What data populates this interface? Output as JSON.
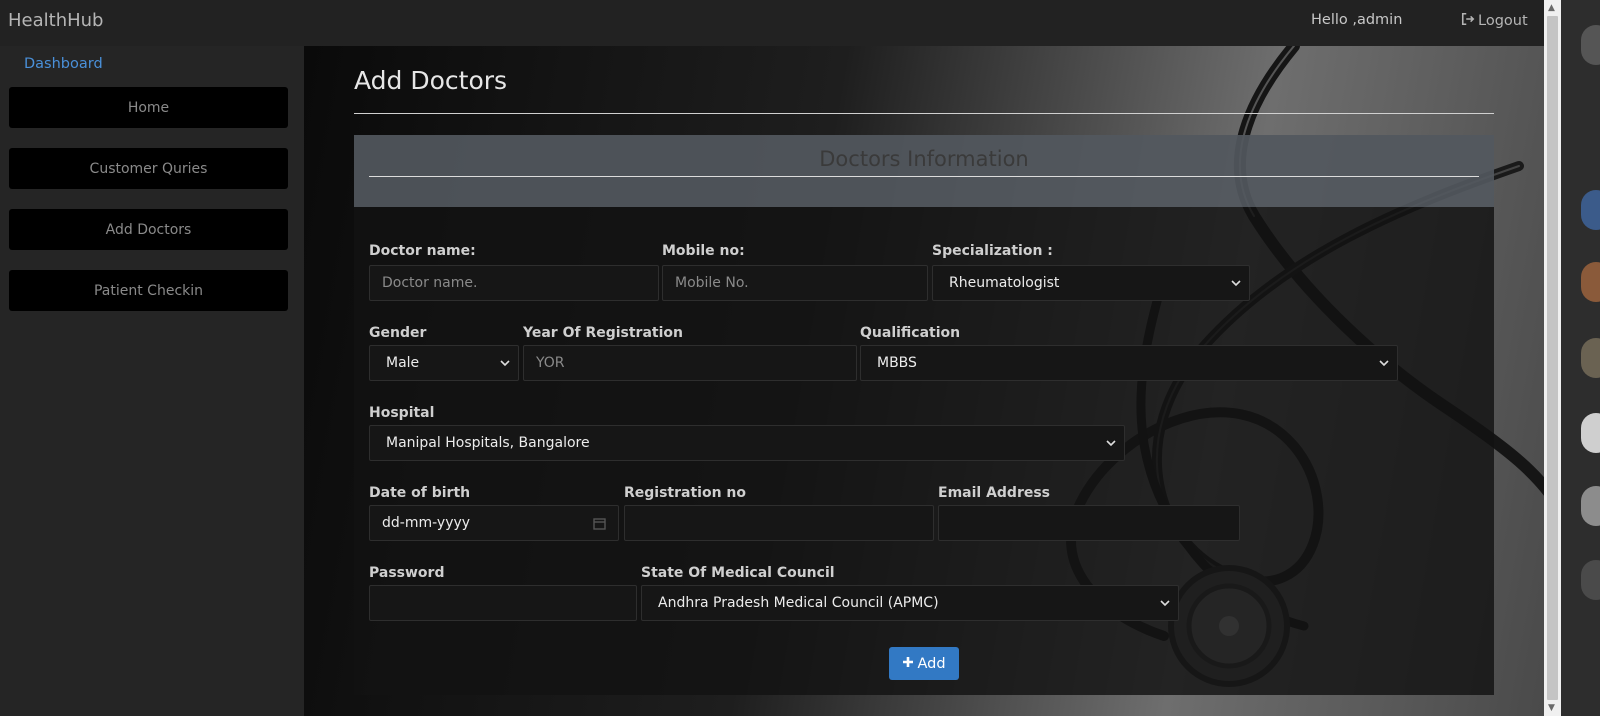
{
  "navbar": {
    "brand": "HealthHub",
    "greeting": "Hello ,admin",
    "logout_label": "Logout"
  },
  "sidebar": {
    "dashboard_label": "Dashboard",
    "items": [
      {
        "label": "Home"
      },
      {
        "label": "Customer Quries"
      },
      {
        "label": "Add Doctors"
      },
      {
        "label": "Patient Checkin"
      }
    ]
  },
  "page": {
    "title": "Add Doctors",
    "panel_title": "Doctors Information"
  },
  "form": {
    "doctor_name": {
      "label": "Doctor name:",
      "placeholder": "Doctor name."
    },
    "mobile": {
      "label": "Mobile no:",
      "placeholder": "Mobile No."
    },
    "specialization": {
      "label": "Specialization :",
      "value": "Rheumatologist"
    },
    "gender": {
      "label": "Gender",
      "value": "Male"
    },
    "year_of_registration": {
      "label": "Year Of Registration",
      "placeholder": "YOR"
    },
    "qualification": {
      "label": "Qualification",
      "value": "MBBS"
    },
    "hospital": {
      "label": "Hospital",
      "value": "Manipal Hospitals, Bangalore"
    },
    "dob": {
      "label": "Date of birth",
      "placeholder": "dd-mm-yyyy"
    },
    "registration_no": {
      "label": "Registration no",
      "value": ""
    },
    "email": {
      "label": "Email Address",
      "value": ""
    },
    "password": {
      "label": "Password",
      "value": ""
    },
    "medical_council": {
      "label": "State Of Medical Council",
      "value": "Andhra Pradesh Medical Council (APMC)"
    },
    "submit_label": "Add"
  },
  "colors": {
    "accent": "#3279c4",
    "link": "#4a90d9",
    "navbar_bg": "#222222",
    "sidebar_button_bg": "#000000"
  }
}
